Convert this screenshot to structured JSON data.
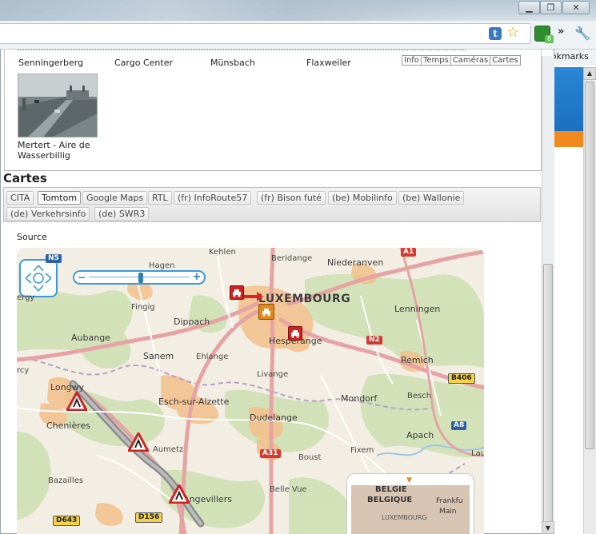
{
  "window": {
    "minimize": "▁",
    "maximize": "❐",
    "close": "✕"
  },
  "toolbar": {
    "t_icon": "t",
    "star": "☆",
    "ext_badge": "8",
    "chevron": "»",
    "wrench": "🔧"
  },
  "bookmarks": {
    "label": "ookmarks"
  },
  "cameras_top": [
    {
      "name": "Senningerberg"
    },
    {
      "name": "Cargo Center"
    },
    {
      "name": "Münsbach"
    },
    {
      "name": "Flaxweiler"
    }
  ],
  "mini_tabs": [
    "Info",
    "Temps",
    "Caméras",
    "Cartes"
  ],
  "camera_thumb": {
    "caption_line1": "Mertert - Aire de",
    "caption_line2": "Wasserbillig"
  },
  "cartes": {
    "heading": "Cartes",
    "tabs": [
      "CITA",
      "Tomtom",
      "Google Maps",
      "RTL",
      "(fr) InfoRoute57",
      "(fr) Bison futé",
      "(be) Mobilinfo",
      "(be) Wallonie",
      "(de) Verkehrsinfo",
      "(de) SWR3"
    ],
    "active_tab": "Tomtom",
    "source_label": "Source"
  },
  "map": {
    "capital": "LUXEMBOURG",
    "places": {
      "kehlen": "Kehlen",
      "berdange": "Beridange",
      "niederanven": "Niederanven",
      "hagen": "Hagen",
      "fingig": "Fingig",
      "dippach": "Dippach",
      "lenningen": "Lenningen",
      "aubange": "Aubange",
      "sanem": "Sanem",
      "ehlange": "Ehlange",
      "hesperange": "Hesperange",
      "remich": "Remich",
      "livange": "Livange",
      "esch": "Esch-sur-Alzette",
      "mondorf": "Mondorf",
      "besch": "Besch",
      "longwy": "Longwy",
      "chenieres": "Chenières",
      "dudelange": "Dudelange",
      "apach": "Apach",
      "aumetz": "Aumetz",
      "fixem": "Fixem",
      "boust": "Boust",
      "bazailles": "Bazailles",
      "angevillers": "Angevillers",
      "belle_vue": "Belle Vue",
      "rcy": "rcy",
      "laur": "Lau",
      "perg": "ergy"
    },
    "roads": {
      "a1": "A1",
      "n2": "N2",
      "b406": "B406",
      "a8": "A8",
      "a31": "A31",
      "d156": "D156",
      "d643": "D643",
      "n5": "N5"
    },
    "inset": {
      "arrow": "▼",
      "belgie": "BELGIE",
      "belgique": "BELGIQUE",
      "frankfurt": "Frankfu",
      "main": "Main",
      "lux": "LUXEMBOURG"
    }
  }
}
